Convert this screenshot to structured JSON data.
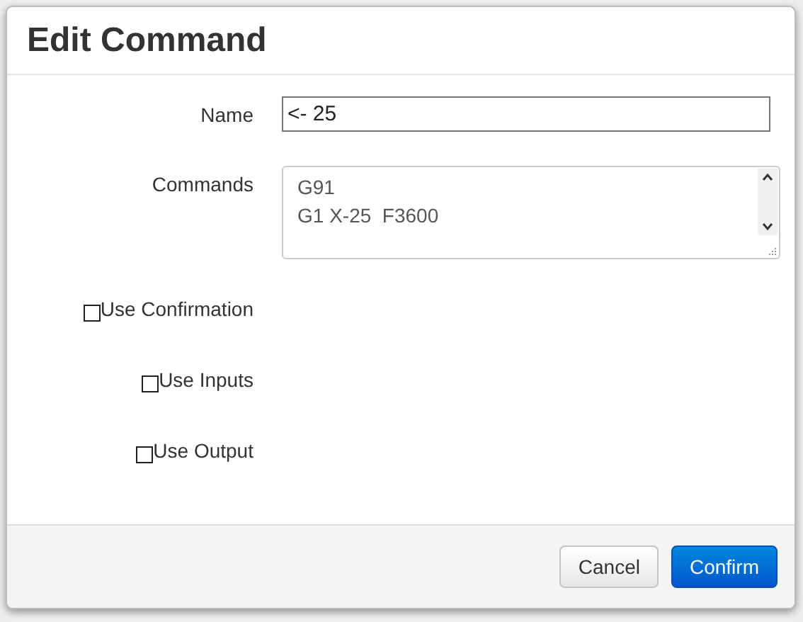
{
  "dialog": {
    "title": "Edit Command",
    "fields": [
      {
        "kind": "input",
        "label": "Name",
        "value": "<- 25"
      },
      {
        "kind": "textarea",
        "label": "Commands",
        "value": "G91\nG1 X-25  F3600"
      }
    ],
    "checkboxes": [
      {
        "label": "Use Confirmation",
        "checked": false
      },
      {
        "label": "Use Inputs",
        "checked": false
      },
      {
        "label": "Use Output",
        "checked": false
      }
    ],
    "buttons": [
      {
        "label": "Cancel",
        "kind": "default"
      },
      {
        "label": "Confirm",
        "kind": "primary"
      }
    ]
  }
}
